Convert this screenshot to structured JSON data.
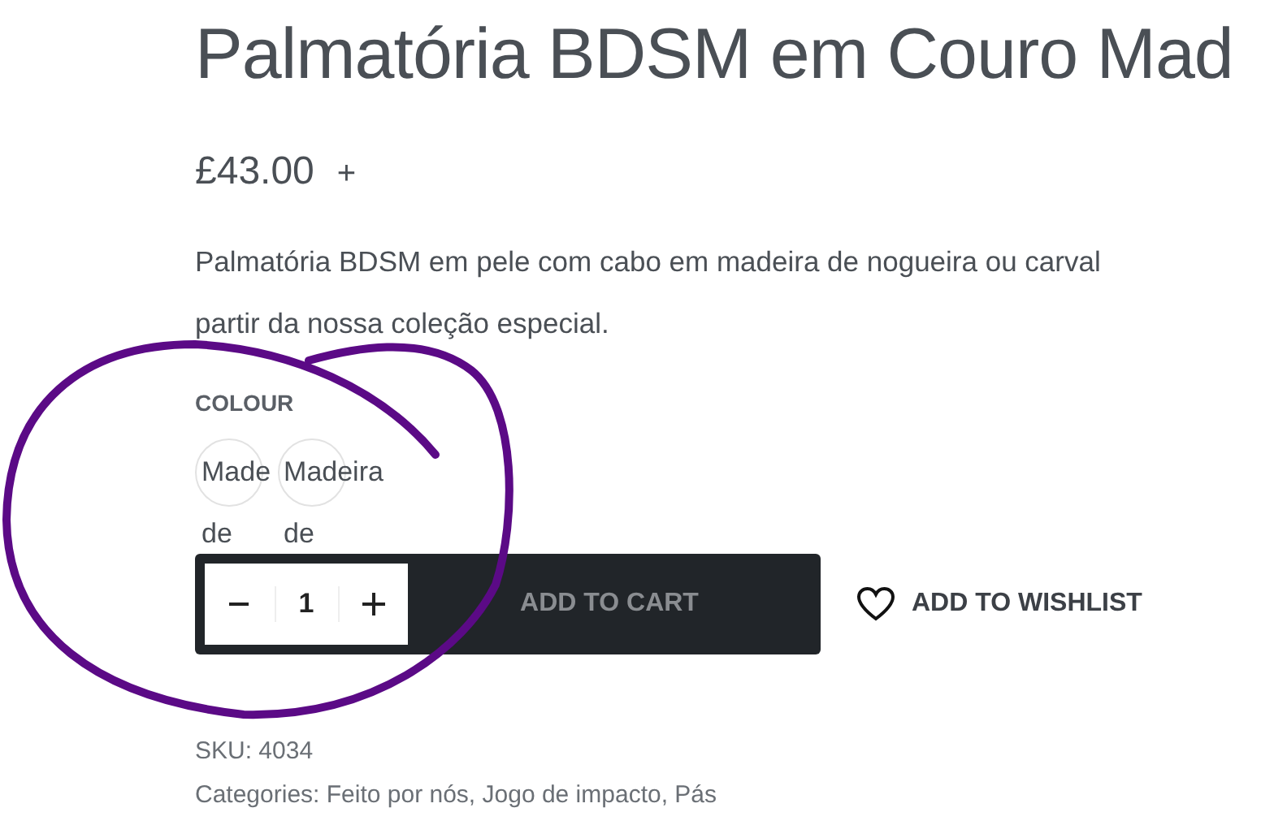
{
  "product": {
    "title": "Palmatória BDSM em Couro Mad",
    "price": "£43.00",
    "price_suffix": "+",
    "description": [
      "Palmatória BDSM em pele com cabo em madeira de nogueira ou carval",
      "partir da nossa coleção especial."
    ]
  },
  "colour": {
    "label": "COLOUR",
    "swatches": [
      {
        "label": "Made",
        "label_line2": "de",
        "selected": false
      },
      {
        "label": "Madeira",
        "label_line2": "de",
        "selected": false
      }
    ]
  },
  "quantity": {
    "value": "1"
  },
  "add_to_cart": {
    "label": "ADD TO CART",
    "disabled": true
  },
  "wishlist": {
    "label": "ADD TO WISHLIST"
  },
  "meta": {
    "sku": "SKU: 4034",
    "categories": "Categories: Feito por nós, Jogo de impacto, Pás"
  },
  "annotation": {
    "kind": "circle"
  }
}
